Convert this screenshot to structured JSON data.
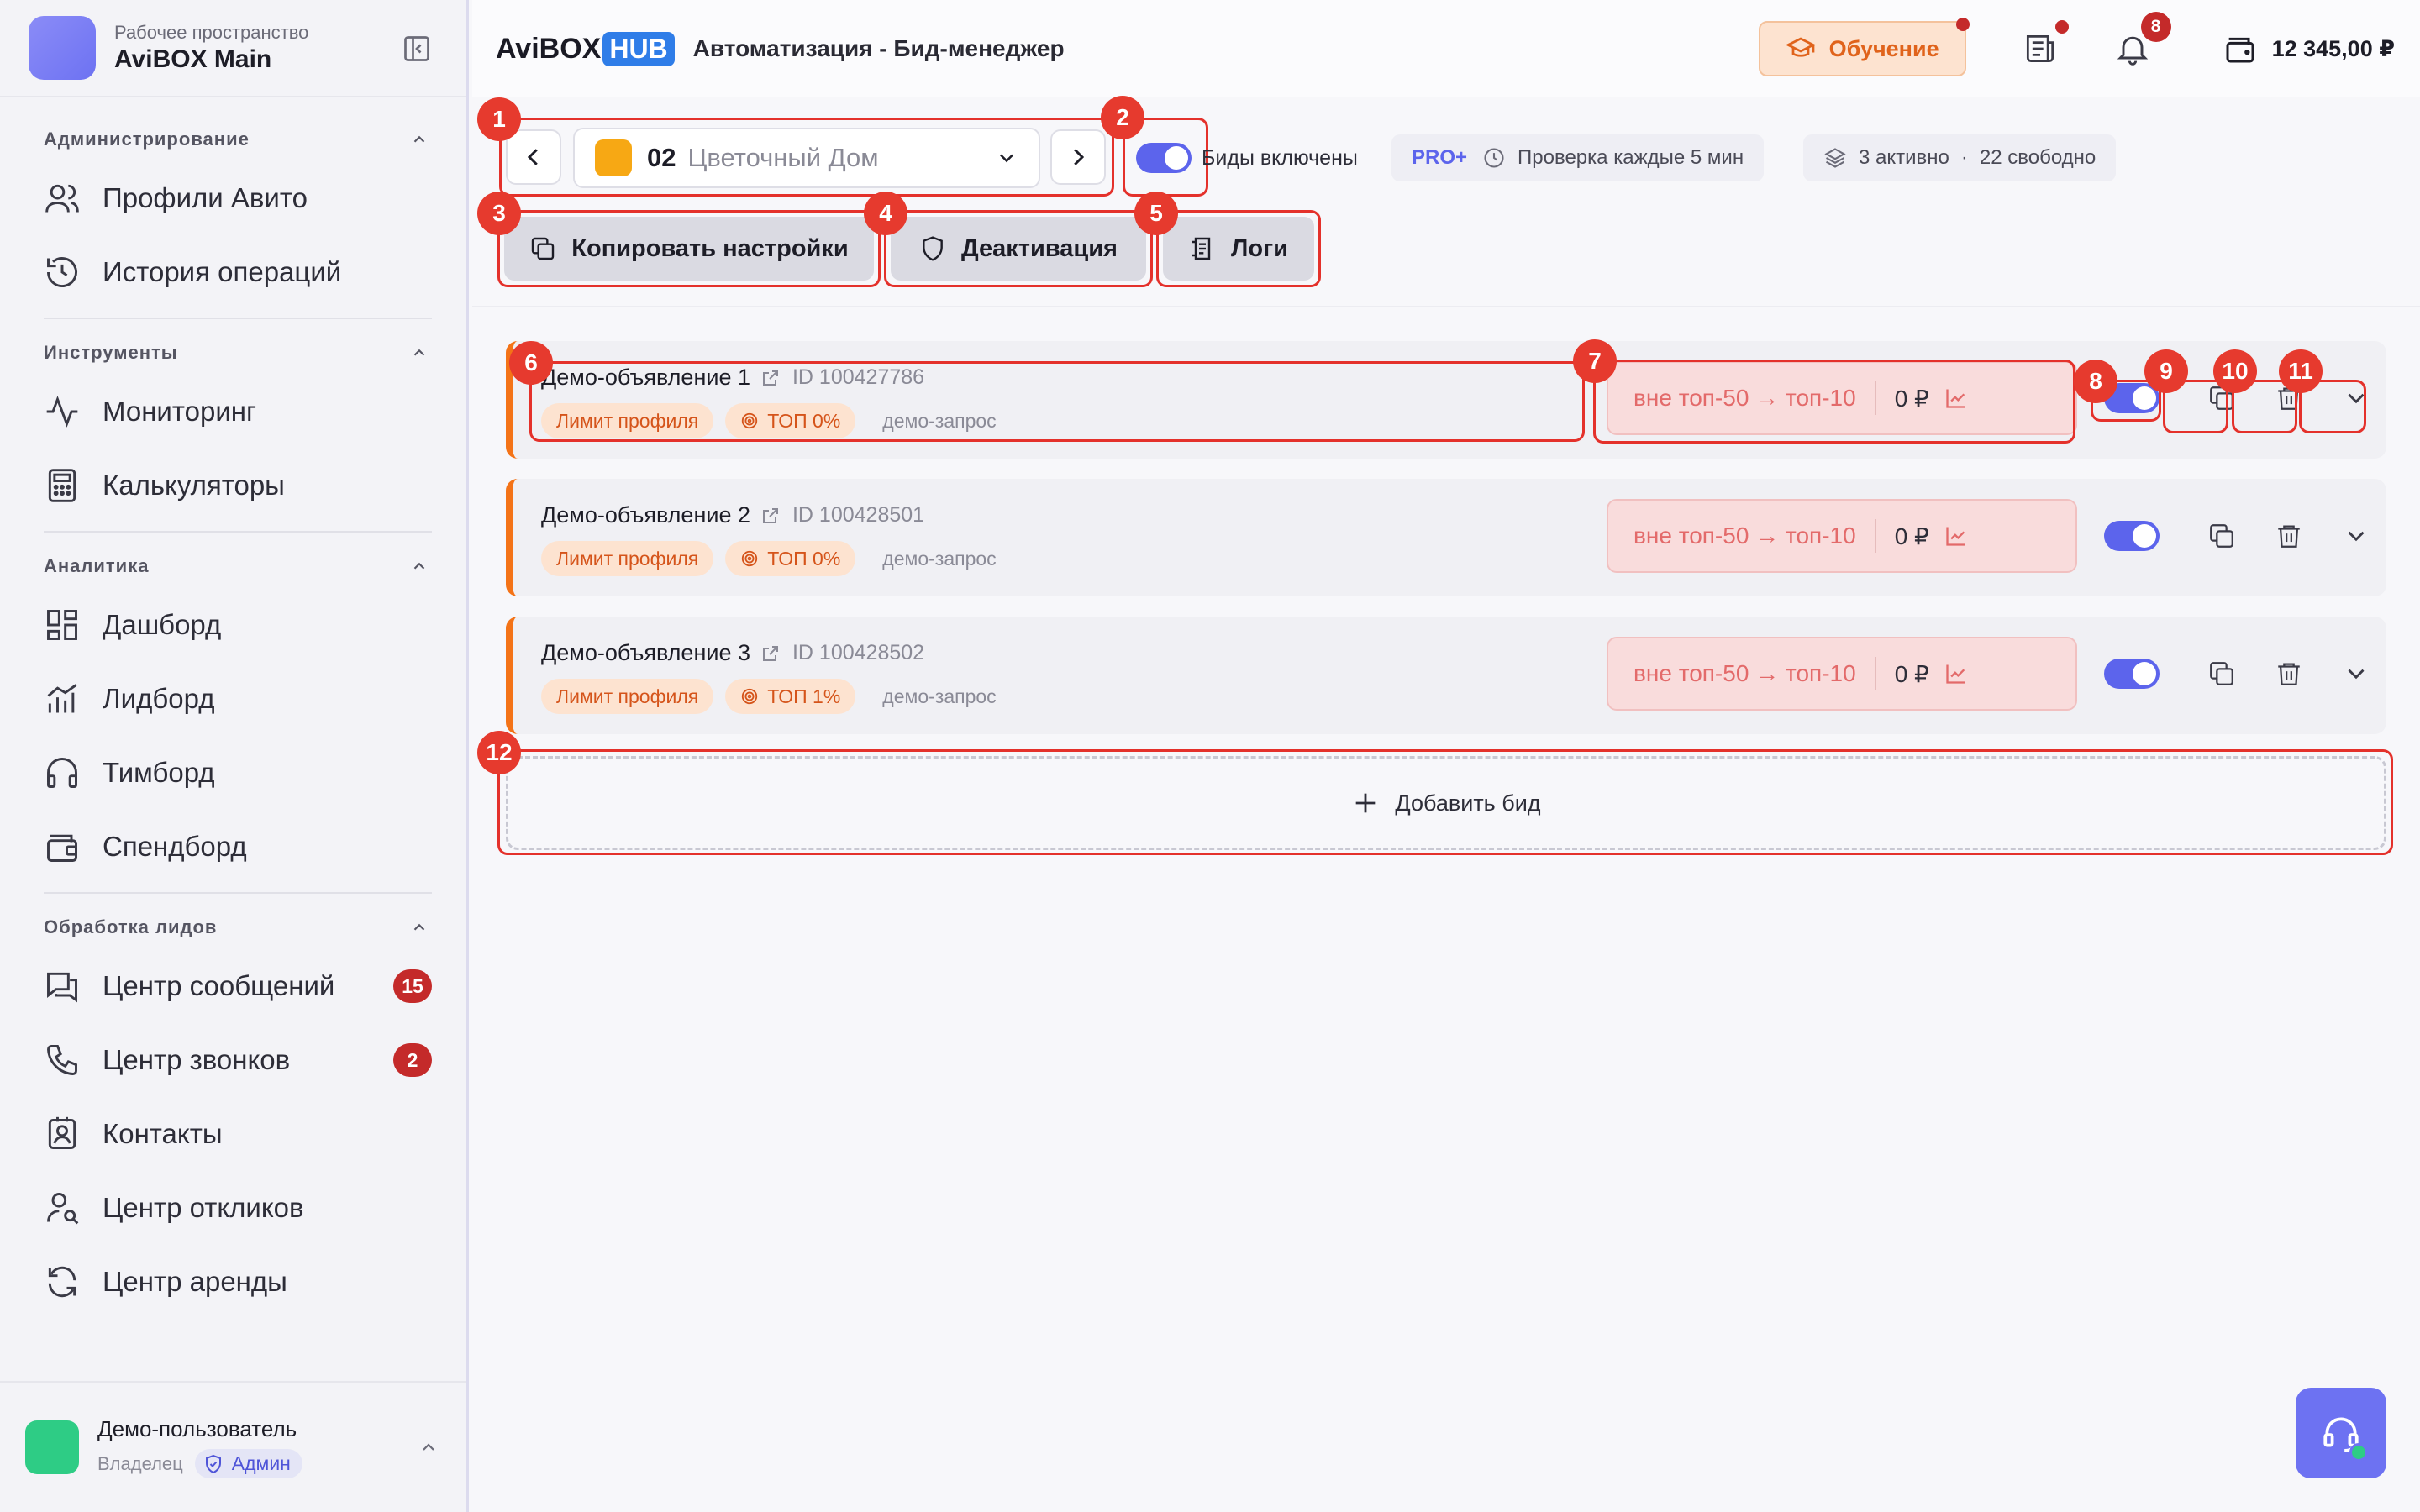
{
  "workspace": {
    "subtitle": "Рабочее пространство",
    "name": "AviBOX Main"
  },
  "sidebar": {
    "sections": [
      {
        "title": "Администрирование",
        "items": [
          "Профили Авито",
          "История операций"
        ]
      },
      {
        "title": "Инструменты",
        "items": [
          "Мониторинг",
          "Калькуляторы"
        ]
      },
      {
        "title": "Аналитика",
        "items": [
          "Дашборд",
          "Лидборд",
          "Тимборд",
          "Спендборд"
        ]
      },
      {
        "title": "Обработка лидов",
        "items": [
          "Центр сообщений",
          "Центр звонков",
          "Контакты",
          "Центр откликов",
          "Центр аренды"
        ]
      }
    ],
    "badges": {
      "messages": "15",
      "calls": "2"
    }
  },
  "user": {
    "name": "Демо-пользователь",
    "role": "Владелец",
    "badge": "Админ"
  },
  "header": {
    "brand_main": "AviBOX",
    "brand_hub": "HUB",
    "title": "Автоматизация - Бид-менеджер",
    "learn_label": "Обучение",
    "notifications_count": "8",
    "balance": "12 345,00 ₽"
  },
  "toolbar": {
    "profile_number": "02",
    "profile_name": "Цветочный Дом",
    "bids_label": "Биды включены",
    "plan": "PRO+",
    "check_interval": "Проверка каждые 5 мин",
    "slots_active": "3 активно",
    "slots_sep": "·",
    "slots_free": "22 свободно",
    "copy_label": "Копировать настройки",
    "deactivate_label": "Деактивация",
    "logs_label": "Логи"
  },
  "annotations": [
    "1",
    "2",
    "3",
    "4",
    "5",
    "6",
    "7",
    "8",
    "9",
    "10",
    "11",
    "12"
  ],
  "bids": [
    {
      "title": "Демо-объявление 1",
      "id": "ID 100427786",
      "tag_limit": "Лимит профиля",
      "tag_top": "ТОП 0%",
      "query": "демо-запрос",
      "position": "вне топ-50 → топ-10",
      "price": "0 ₽",
      "enabled": true
    },
    {
      "title": "Демо-объявление 2",
      "id": "ID 100428501",
      "tag_limit": "Лимит профиля",
      "tag_top": "ТОП 0%",
      "query": "демо-запрос",
      "position": "вне топ-50 → топ-10",
      "price": "0 ₽",
      "enabled": true
    },
    {
      "title": "Демо-объявление 3",
      "id": "ID 100428502",
      "tag_limit": "Лимит профиля",
      "tag_top": "ТОП 1%",
      "query": "демо-запрос",
      "position": "вне топ-50 → топ-10",
      "price": "0 ₽",
      "enabled": true
    }
  ],
  "add_bid_label": "Добавить бид",
  "colors": {
    "accent": "#5c64ec",
    "orange": "#f47317",
    "highlight": "#e4312b",
    "badge_red": "#c42a2a"
  }
}
